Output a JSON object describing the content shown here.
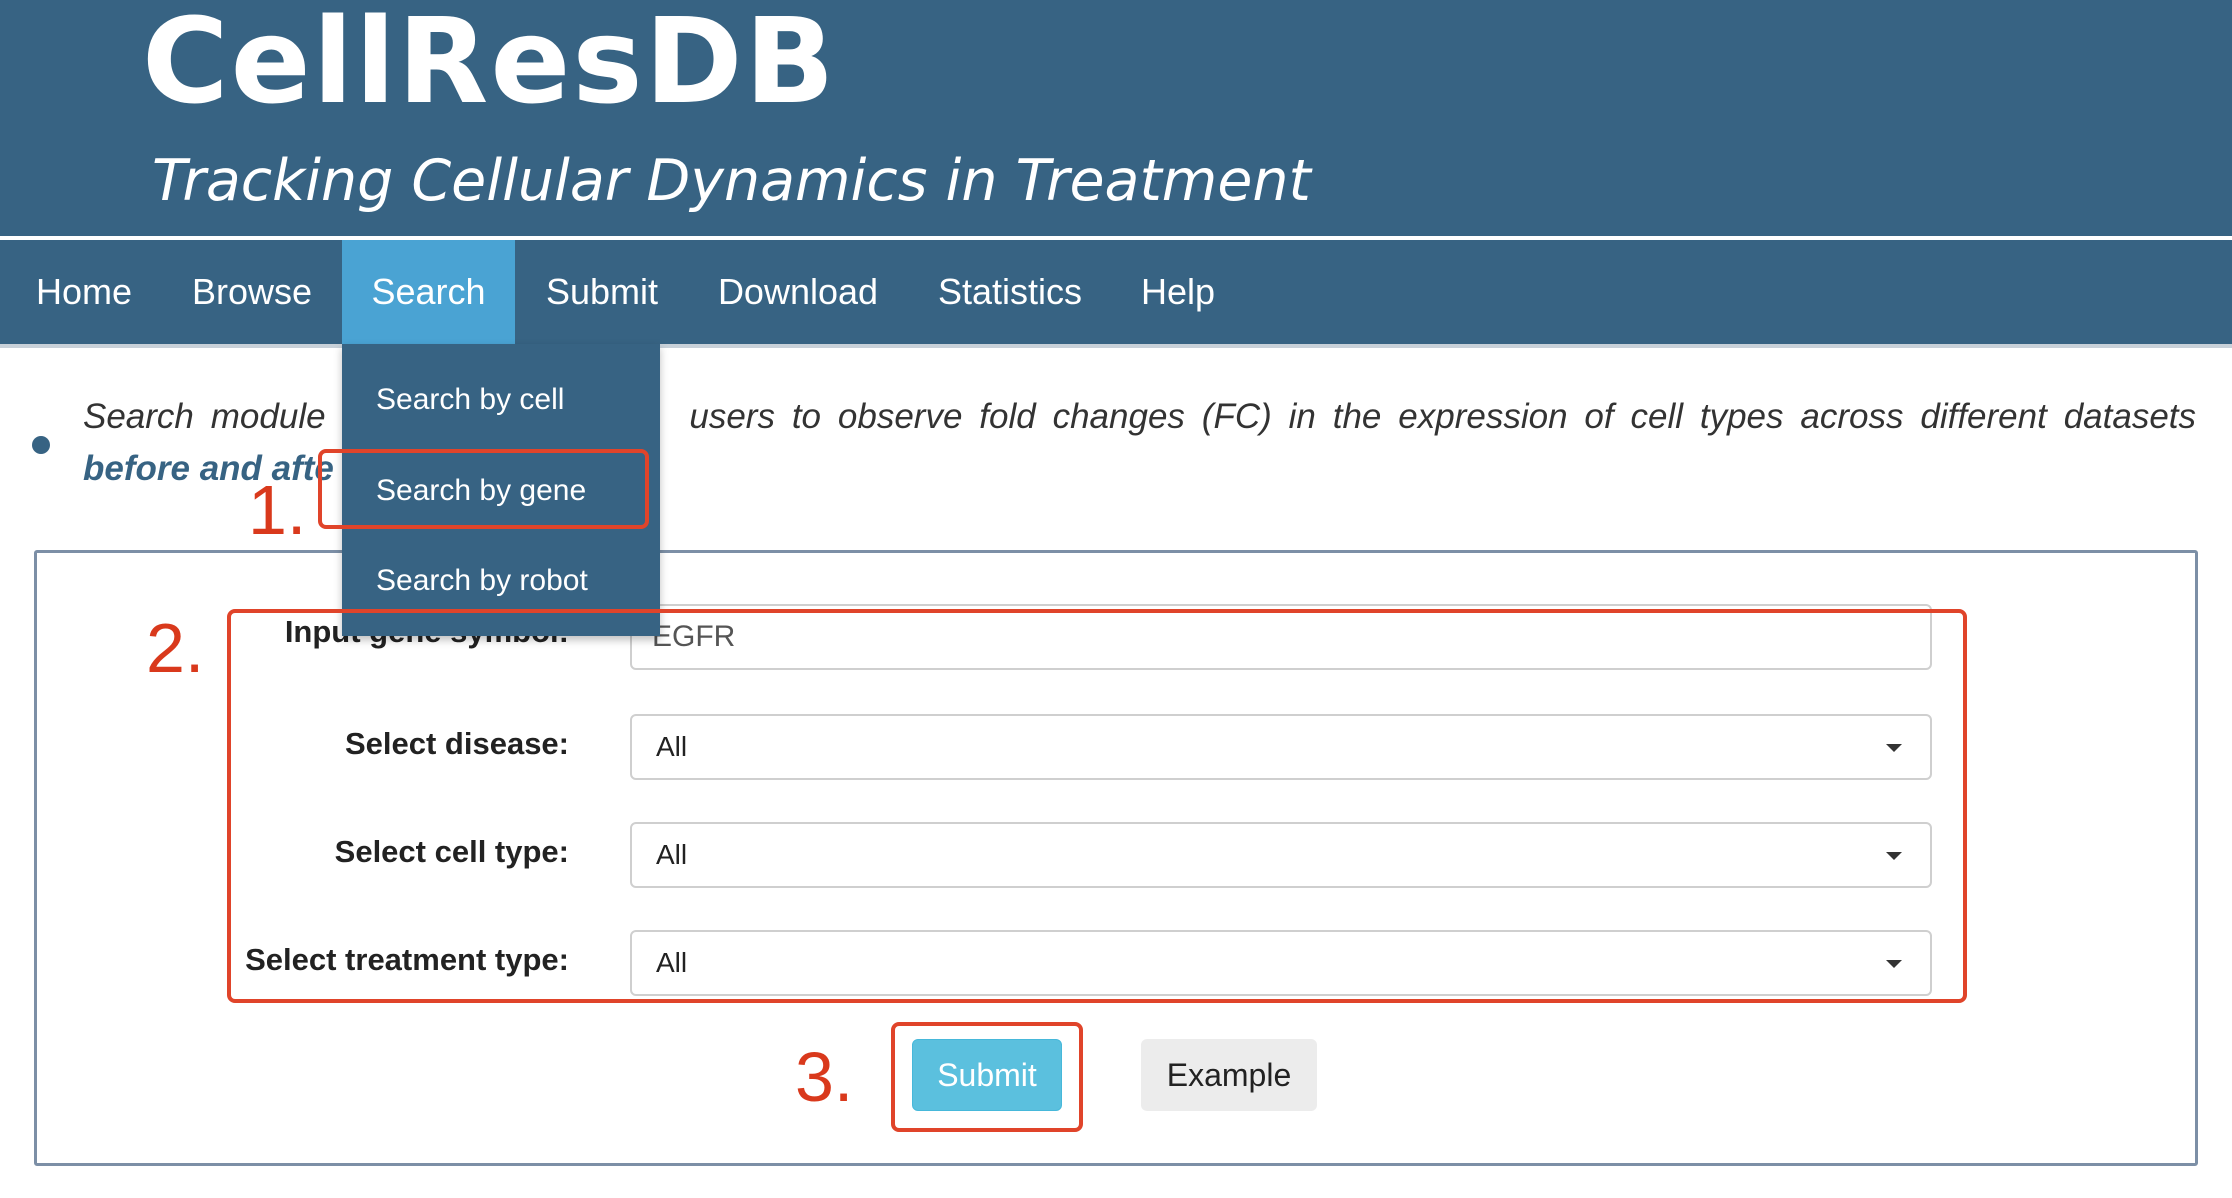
{
  "header": {
    "title": "CellResDB",
    "subtitle": "Tracking Cellular Dynamics in Treatment"
  },
  "nav": {
    "items": [
      {
        "label": "Home"
      },
      {
        "label": "Browse"
      },
      {
        "label": "Search",
        "active": true
      },
      {
        "label": "Submit"
      },
      {
        "label": "Download"
      },
      {
        "label": "Statistics"
      },
      {
        "label": "Help"
      }
    ]
  },
  "dropdown": {
    "items": [
      {
        "label": "Search by cell"
      },
      {
        "label": "Search by gene"
      },
      {
        "label": "Search by robot"
      }
    ]
  },
  "intro": {
    "line1_start": "Search module",
    "line1_end": "users to observe fold changes (FC) in the expression of cell types across different datasets",
    "line2": "before and afte"
  },
  "form": {
    "gene_label": "Input gene symbol:",
    "gene_value": "EGFR",
    "disease_label": "Select disease:",
    "disease_value": "All",
    "cell_type_label": "Select cell type:",
    "cell_type_value": "All",
    "treatment_label": "Select treatment type:",
    "treatment_value": "All",
    "submit_label": "Submit",
    "example_label": "Example"
  },
  "annotations": {
    "step1": "1.",
    "step2": "2.",
    "step3": "3.",
    "color": "#e0442a"
  },
  "colors": {
    "header_bg": "#376383",
    "nav_active": "#4aa3d3",
    "submit_button": "#5bc0de"
  }
}
